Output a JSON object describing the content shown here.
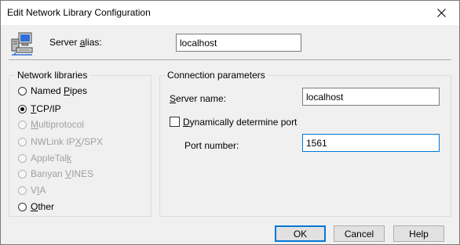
{
  "window": {
    "title": "Edit Network Library Configuration"
  },
  "icons": {
    "close": "close-icon",
    "server": "computer-network-icon"
  },
  "alias": {
    "label_prefix": "Server ",
    "label_accel": "a",
    "label_suffix": "lias:",
    "value": "localhost"
  },
  "libraries": {
    "legend": "Network libraries",
    "items": [
      {
        "pre": "Named ",
        "acc": "P",
        "post": "ipes",
        "checked": false,
        "enabled": true
      },
      {
        "pre": "",
        "acc": "T",
        "post": "CP/IP",
        "checked": true,
        "enabled": true
      },
      {
        "pre": "",
        "acc": "M",
        "post": "ultiprotocol",
        "checked": false,
        "enabled": false
      },
      {
        "pre": "NWLink IP",
        "acc": "X",
        "post": "/SPX",
        "checked": false,
        "enabled": false
      },
      {
        "pre": "AppleTal",
        "acc": "k",
        "post": "",
        "checked": false,
        "enabled": false
      },
      {
        "pre": "Banyan ",
        "acc": "V",
        "post": "INES",
        "checked": false,
        "enabled": false
      },
      {
        "pre": "V",
        "acc": "I",
        "post": "A",
        "checked": false,
        "enabled": false
      },
      {
        "pre": "",
        "acc": "O",
        "post": "ther",
        "checked": false,
        "enabled": true
      }
    ]
  },
  "connection": {
    "legend": "Connection parameters",
    "server_name": {
      "label_accel": "S",
      "label_rest": "erver name:",
      "value": "localhost"
    },
    "dynamic": {
      "label_accel": "D",
      "label_rest": "ynamically determine port",
      "checked": false
    },
    "port": {
      "label": "Port number:",
      "value": "1561"
    }
  },
  "buttons": {
    "ok": "OK",
    "cancel": "Cancel",
    "help": "Help"
  },
  "colors": {
    "accent": "#0078d7",
    "disabled_text": "#a0a0a0",
    "window_bg": "#f0f0f0"
  }
}
